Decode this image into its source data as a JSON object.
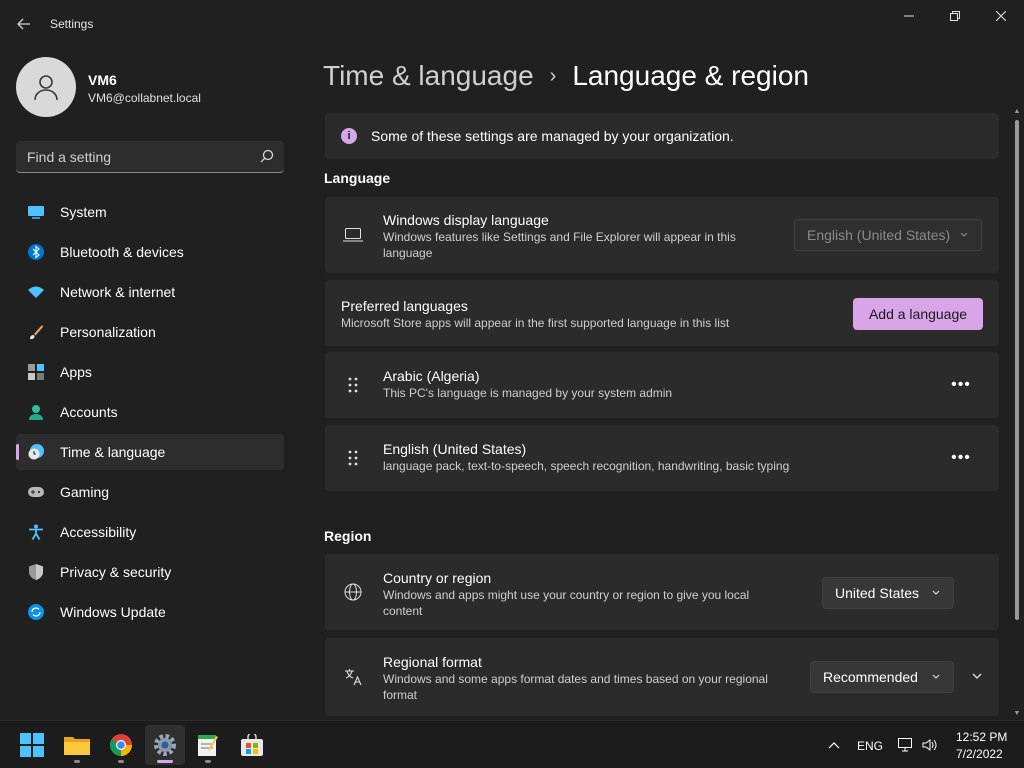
{
  "window": {
    "title": "Settings",
    "back_icon": "back-arrow-icon",
    "controls": [
      "minimize-icon",
      "restore-icon",
      "close-icon"
    ]
  },
  "profile": {
    "name": "VM6",
    "email": "VM6@collabnet.local"
  },
  "search": {
    "placeholder": "Find a setting"
  },
  "sidebar": {
    "items": [
      {
        "label": "System",
        "icon": "system-icon",
        "active": false
      },
      {
        "label": "Bluetooth & devices",
        "icon": "bluetooth-icon",
        "active": false
      },
      {
        "label": "Network & internet",
        "icon": "wifi-icon",
        "active": false
      },
      {
        "label": "Personalization",
        "icon": "brush-icon",
        "active": false
      },
      {
        "label": "Apps",
        "icon": "apps-icon",
        "active": false
      },
      {
        "label": "Accounts",
        "icon": "accounts-icon",
        "active": false
      },
      {
        "label": "Time & language",
        "icon": "time-language-icon",
        "active": true
      },
      {
        "label": "Gaming",
        "icon": "gaming-icon",
        "active": false
      },
      {
        "label": "Accessibility",
        "icon": "accessibility-icon",
        "active": false
      },
      {
        "label": "Privacy & security",
        "icon": "shield-icon",
        "active": false
      },
      {
        "label": "Windows Update",
        "icon": "update-icon",
        "active": false
      }
    ]
  },
  "breadcrumb": {
    "parent": "Time & language",
    "separator": "›",
    "current": "Language & region"
  },
  "notice": {
    "text": "Some of these settings are managed by your organization."
  },
  "language": {
    "heading": "Language",
    "display_language": {
      "title": "Windows display language",
      "desc": "Windows features like Settings and File Explorer will appear in this language",
      "value": "English (United States)"
    },
    "preferred": {
      "title": "Preferred languages",
      "desc": "Microsoft Store apps will appear in the first supported language in this list",
      "button": "Add a language"
    },
    "languages": [
      {
        "name": "Arabic (Algeria)",
        "desc": "This PC's language is managed by your system admin"
      },
      {
        "name": "English (United States)",
        "desc": "language pack, text-to-speech, speech recognition, handwriting, basic typing"
      }
    ],
    "more_label": "•••"
  },
  "region": {
    "heading": "Region",
    "country": {
      "title": "Country or region",
      "desc": "Windows and apps might use your country or region to give you local content",
      "value": "United States"
    },
    "format": {
      "title": "Regional format",
      "desc": "Windows and some apps format dates and times based on your regional format",
      "value": "Recommended"
    }
  },
  "taskbar": {
    "apps": [
      "windows-start-icon",
      "file-explorer-icon",
      "chrome-icon",
      "settings-icon",
      "notepad-icon",
      "store-icon"
    ],
    "lang": "ENG",
    "time": "12:52 PM",
    "date": "7/2/2022"
  },
  "colors": {
    "accent": "#d7a5e8",
    "background": "#202020",
    "card": "#2b2b2b"
  }
}
